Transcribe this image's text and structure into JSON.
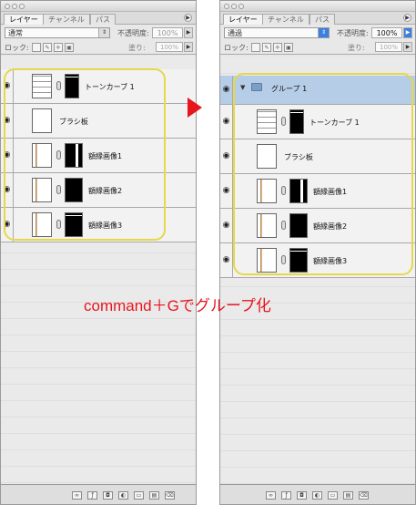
{
  "panel_tabs": [
    "レイヤー",
    "チャンネル",
    "パス"
  ],
  "tab_menu_arrow": "▶",
  "left_panel": {
    "blend_mode": "通常",
    "opacity_label": "不透明度:",
    "opacity_value": "100%",
    "lock_label": "ロック:",
    "fill_label": "塗り:",
    "fill_value": "100%",
    "layers": [
      {
        "name": "トーンカーブ 1",
        "type": "adjustment",
        "visible": true
      },
      {
        "name": "ブラシ板",
        "type": "normal",
        "visible": true
      },
      {
        "name": "額縁画像1",
        "type": "image",
        "visible": true
      },
      {
        "name": "額縁画像2",
        "type": "image",
        "visible": true
      },
      {
        "name": "額縁画像3",
        "type": "image",
        "visible": true
      }
    ]
  },
  "right_panel": {
    "blend_mode": "通過",
    "opacity_label": "不透明度:",
    "opacity_value": "100%",
    "lock_label": "ロック:",
    "fill_label": "塗り:",
    "fill_value": "100%",
    "group_name": "グループ 1",
    "layers": [
      {
        "name": "トーンカーブ 1",
        "type": "adjustment",
        "visible": true
      },
      {
        "name": "ブラシ板",
        "type": "normal",
        "visible": true
      },
      {
        "name": "額縁画像1",
        "type": "image",
        "visible": true
      },
      {
        "name": "額縁画像2",
        "type": "image",
        "visible": true
      },
      {
        "name": "額縁画像3",
        "type": "image",
        "visible": true
      }
    ]
  },
  "eye_icon_glyph": "◉",
  "callout_text": "command＋Gでグループ化",
  "colors": {
    "highlight_border": "#e6d84a",
    "annotation_red": "#e8151f",
    "group_selected": "#b6cde8"
  }
}
